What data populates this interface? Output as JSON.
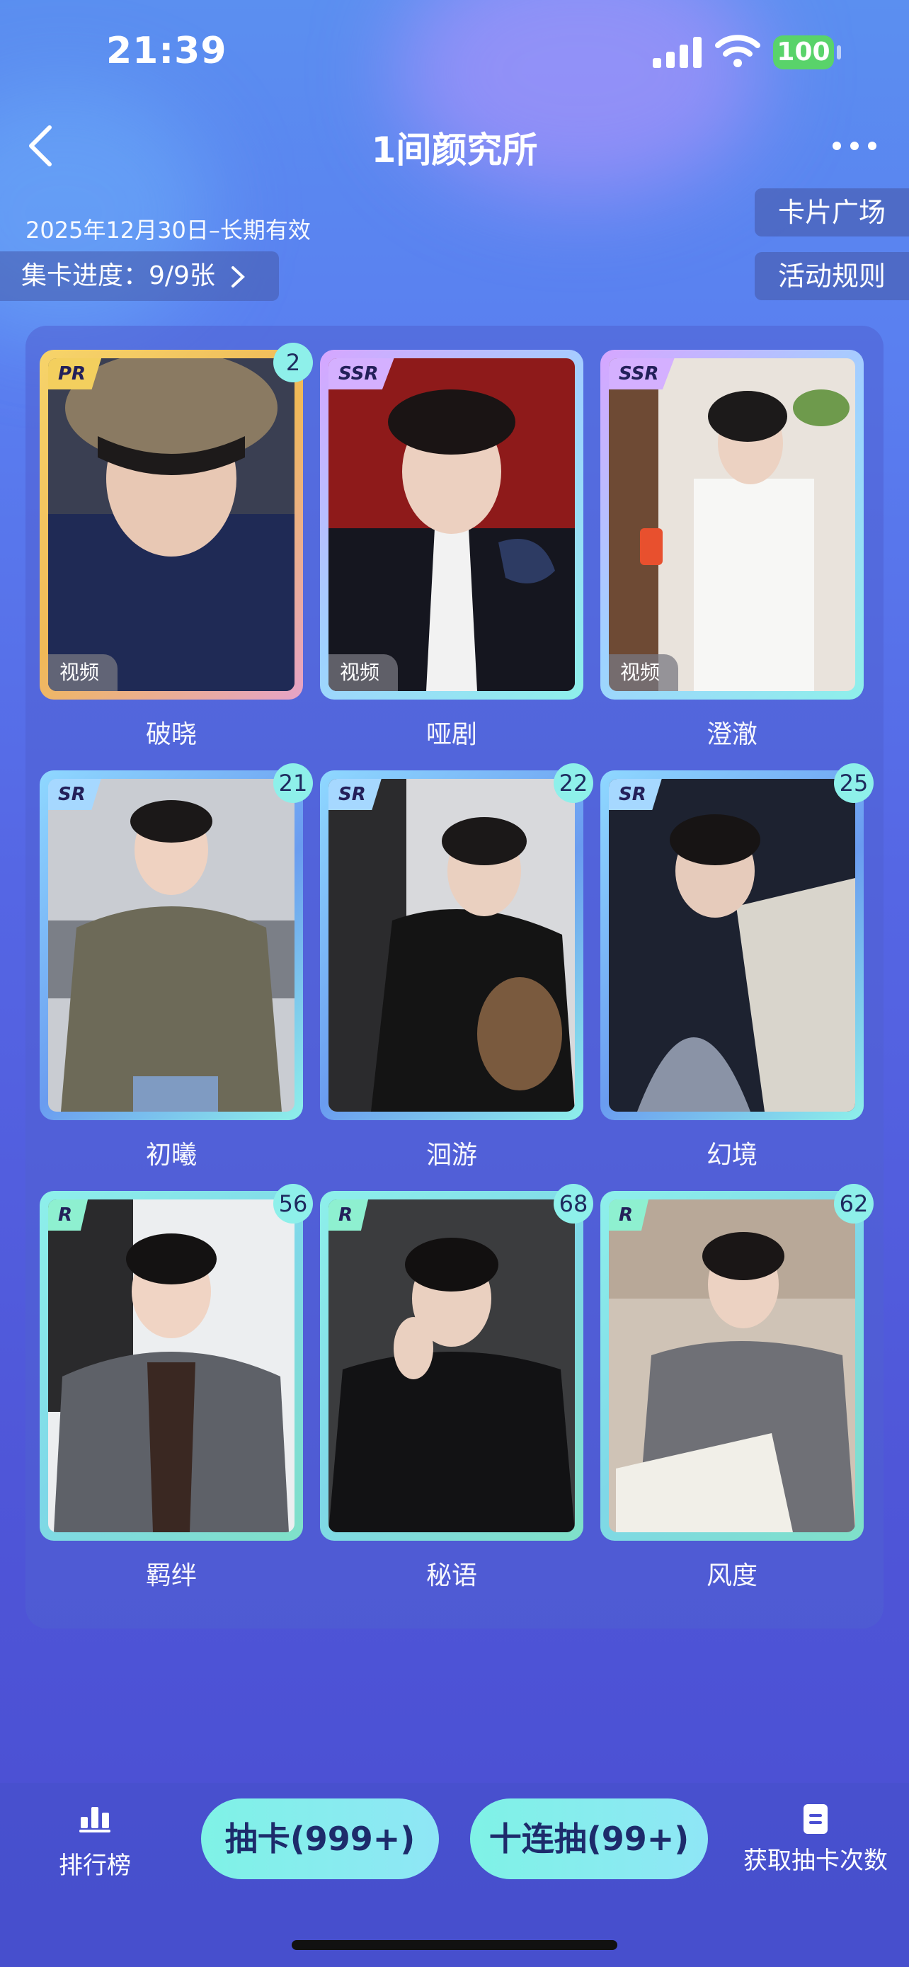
{
  "status_bar": {
    "time": "21:39",
    "battery": "100"
  },
  "header": {
    "title": "1间颜究所"
  },
  "event": {
    "date_range": "2025年12月30日–长期有效",
    "progress_label": "集卡进度：9/9张"
  },
  "side_buttons": {
    "card_plaza": "卡片广场",
    "rules": "活动规则"
  },
  "cards": [
    {
      "rarity": "PR",
      "count": "2",
      "name": "破晓",
      "video_label": "视频"
    },
    {
      "rarity": "SSR",
      "count": "",
      "name": "哑剧",
      "video_label": "视频"
    },
    {
      "rarity": "SSR",
      "count": "",
      "name": "澄澈",
      "video_label": "视频"
    },
    {
      "rarity": "SR",
      "count": "21",
      "name": "初曦",
      "video_label": ""
    },
    {
      "rarity": "SR",
      "count": "22",
      "name": "洄游",
      "video_label": ""
    },
    {
      "rarity": "SR",
      "count": "25",
      "name": "幻境",
      "video_label": ""
    },
    {
      "rarity": "R",
      "count": "56",
      "name": "羁绊",
      "video_label": ""
    },
    {
      "rarity": "R",
      "count": "68",
      "name": "秘语",
      "video_label": ""
    },
    {
      "rarity": "R",
      "count": "62",
      "name": "风度",
      "video_label": ""
    }
  ],
  "bottom": {
    "leaderboard": "排行榜",
    "draw_one": "抽卡(999+)",
    "draw_ten": "十连抽(99+)",
    "get_draws": "获取抽卡次数"
  },
  "icons": [
    "back-chevron-icon",
    "more-dots-icon",
    "chevron-right-icon",
    "signal-icon",
    "wifi-icon",
    "leaderboard-icon",
    "document-icon"
  ],
  "colors": {
    "accent": "#8ef0ea",
    "pr_frame": "#f2c94c",
    "ssr_frame": "#c9a6ff",
    "sr_frame": "#7fb6f5",
    "r_frame": "#7fe0c8",
    "battery": "#59d36a"
  }
}
